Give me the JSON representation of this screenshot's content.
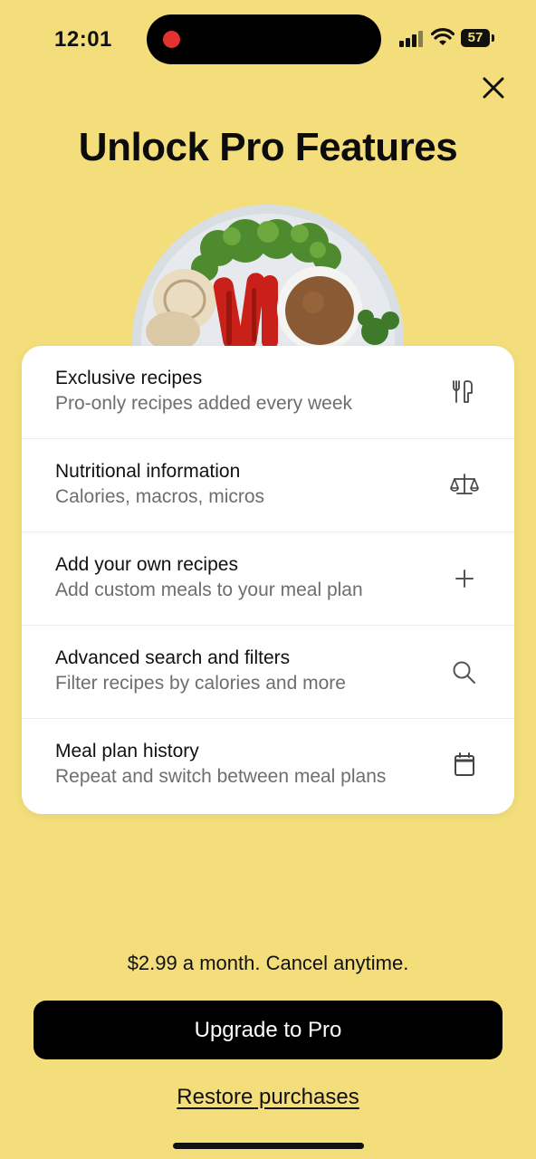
{
  "status_bar": {
    "time": "12:01",
    "battery": "57"
  },
  "title": "Unlock Pro Features",
  "features": [
    {
      "title": "Exclusive recipes",
      "subtitle": "Pro-only recipes added every week",
      "icon": "fork-knife-icon"
    },
    {
      "title": "Nutritional information",
      "subtitle": "Calories, macros, micros",
      "icon": "scale-icon"
    },
    {
      "title": "Add your own recipes",
      "subtitle": "Add custom meals to your meal plan",
      "icon": "plus-icon"
    },
    {
      "title": "Advanced search and filters",
      "subtitle": "Filter recipes by calories and more",
      "icon": "search-icon"
    },
    {
      "title": "Meal plan history",
      "subtitle": "Repeat and switch between meal plans",
      "icon": "calendar-icon"
    }
  ],
  "price_text": "$2.99 a month. Cancel anytime.",
  "upgrade_label": "Upgrade to Pro",
  "restore_label": "Restore purchases",
  "colors": {
    "background": "#F3DE7B",
    "button": "#000000",
    "card": "#FFFFFF"
  }
}
